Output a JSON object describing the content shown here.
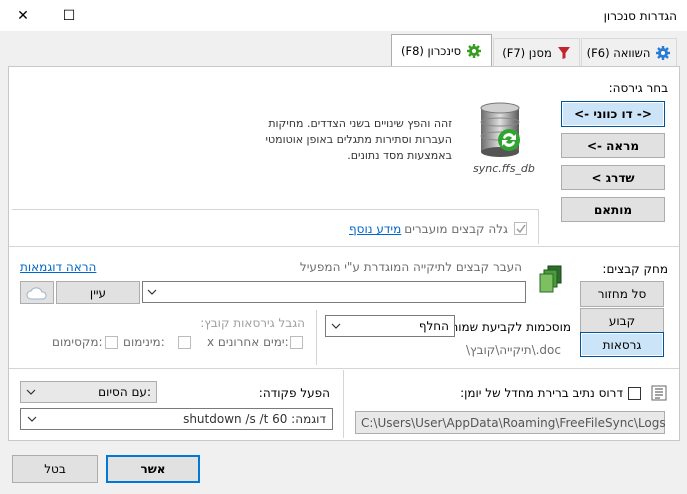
{
  "window": {
    "title": "הגדרות סנכרון",
    "minimize": "—",
    "maximize": "☐",
    "close": "✕"
  },
  "tabs": [
    {
      "label": "סינכרון (F8)",
      "icon": "gear-icon",
      "active": true
    },
    {
      "label": "מסנן (F7)",
      "icon": "funnel-icon",
      "active": false
    },
    {
      "label": "השוואה (F6)",
      "icon": "gear-icon",
      "active": false
    }
  ],
  "variant": {
    "heading": "בחר גירסה:",
    "buttons": [
      "<- דו כווני ->",
      "מראה ->",
      "שדרג >",
      "מותאם"
    ],
    "selected_index": 0,
    "db_caption": "sync.ffs_db",
    "description": "זהה והפץ שינויים בשני הצדדים. מחיקות העברות וסתירות מתגלים באופן אוטומטי באמצעות מסד נתונים."
  },
  "detect_moved": {
    "label": "גלה קבצים מועברים",
    "checked": true,
    "more_info": "מידע נוסף"
  },
  "deletion": {
    "heading": "מחק קבצים:",
    "buttons": [
      "סל מחזור",
      "קבוע",
      "גרסאות"
    ],
    "selected_index": 2,
    "hint": "העבר קבצים לתיקייה המוגדרת ע\"י המפעיל",
    "example_link": "הראה דוגמאות",
    "browse": "עיין",
    "folder_value": "",
    "naming_label": "מוסכמות לקביעת שמות:",
    "naming_value": "החלף",
    "naming_example": "\\תיקייה\\קובץ\\.doc",
    "limit_heading": "הגבל גירסאות קובץ:",
    "limit_options": [
      "x ימים אחרונים:",
      "מינימום:",
      "מקסימום:"
    ]
  },
  "logfile": {
    "label": "דרוס נתיב ברירת מחדל של יומן:",
    "checked": false,
    "path": "C:\\Users\\User\\AppData\\Roaming\\FreeFileSync\\Logs"
  },
  "post_command": {
    "label": "הפעל פקודה:",
    "when": "עם הסיום:",
    "value": "shutdown /s /t 60 :דוגמה"
  },
  "footer": {
    "ok": "אשר",
    "cancel": "בטל"
  }
}
